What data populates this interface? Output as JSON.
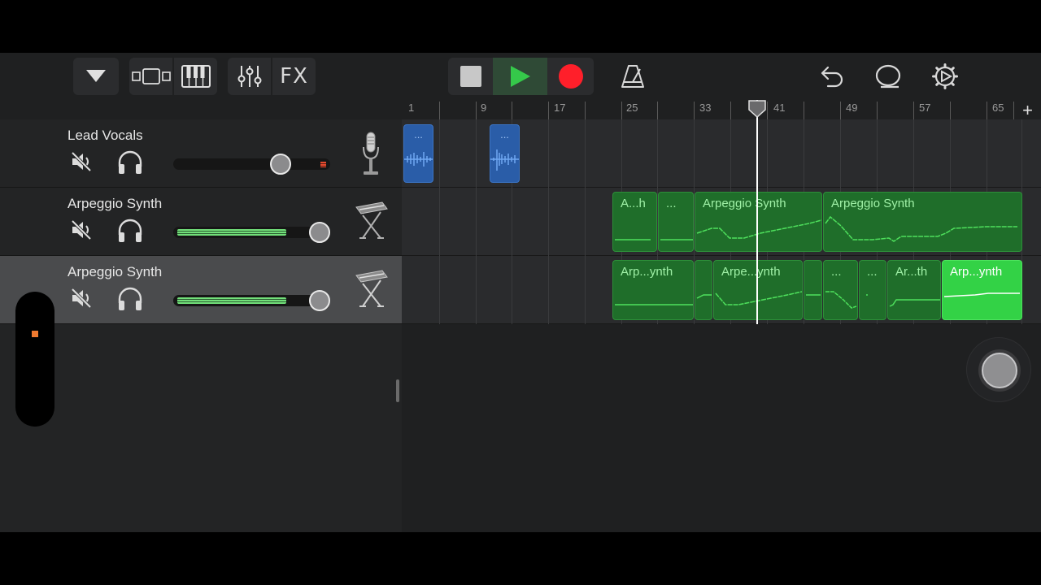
{
  "toolbar": {
    "buttons": [
      "tracks-menu",
      "browser-view",
      "keyboard-view",
      "mixer",
      "fx",
      "stop",
      "play",
      "record",
      "metronome",
      "undo",
      "loop-browser",
      "settings"
    ],
    "fx_label": "FX"
  },
  "ruler": {
    "bars": [
      "1",
      "9",
      "17",
      "25",
      "33",
      "41",
      "49",
      "57",
      "65"
    ]
  },
  "tracks": [
    {
      "name": "Lead Vocals",
      "instrument": "microphone-icon",
      "volume": 0.68,
      "selected": false
    },
    {
      "name": "Arpeggio Synth",
      "instrument": "keyboard-stand-icon",
      "volume": 0.78,
      "selected": false
    },
    {
      "name": "Arpeggio Synth",
      "instrument": "keyboard-stand-icon",
      "volume": 0.78,
      "selected": true
    }
  ],
  "regions": {
    "vocals": [
      {
        "label": "..."
      },
      {
        "label": "..."
      }
    ],
    "synth1": [
      {
        "label": "A...h"
      },
      {
        "label": "..."
      },
      {
        "label": "Arpeggio Synth"
      },
      {
        "label": "Arpeggio Synth"
      }
    ],
    "synth2": [
      {
        "label": "Arp...ynth"
      },
      {
        "label": ""
      },
      {
        "label": "Arpe...ynth"
      },
      {
        "label": ""
      },
      {
        "label": "..."
      },
      {
        "label": "..."
      },
      {
        "label": "Ar...th"
      },
      {
        "label": "Arp...ynth"
      }
    ]
  },
  "colors": {
    "audio_region": "#2a5da8",
    "midi_region": "#1f6e2a",
    "midi_selected": "#33d246",
    "play": "#35c94a",
    "record": "#ff1f2a",
    "peak": "#e64b2f"
  }
}
